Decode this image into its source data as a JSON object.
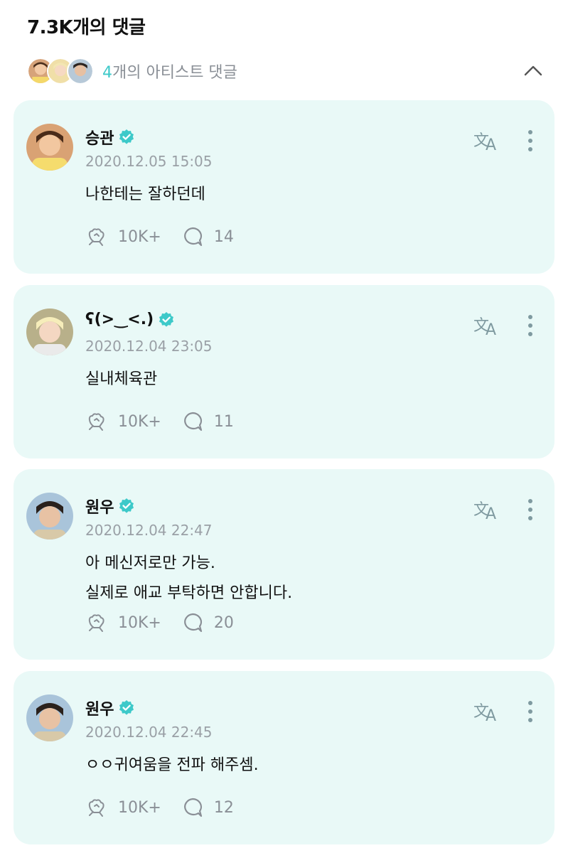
{
  "header": {
    "title": "7.3K개의 댓글"
  },
  "artist_bar": {
    "count": "4",
    "label_suffix": "개의 아티스트 댓글"
  },
  "colors": {
    "accent": "#3dc9c9",
    "card_bg": "#e9f9f7",
    "muted": "#8a8f96"
  },
  "comments": [
    {
      "name": "승관",
      "timestamp": "2020.12.05 15:05",
      "lines": [
        "나한테는 잘하던데"
      ],
      "likes": "10K+",
      "replies": "14"
    },
    {
      "name": "ʕ(>‿<.)",
      "timestamp": "2020.12.04 23:05",
      "lines": [
        "실내체육관"
      ],
      "likes": "10K+",
      "replies": "11"
    },
    {
      "name": "원우",
      "timestamp": "2020.12.04 22:47",
      "lines": [
        "아 메신저로만 가능.",
        "실제로 애교 부탁하면 안합니다."
      ],
      "likes": "10K+",
      "replies": "20"
    },
    {
      "name": "원우",
      "timestamp": "2020.12.04 22:45",
      "lines": [
        "ㅇㅇ귀여움을 전파 해주셈."
      ],
      "likes": "10K+",
      "replies": "12"
    }
  ]
}
